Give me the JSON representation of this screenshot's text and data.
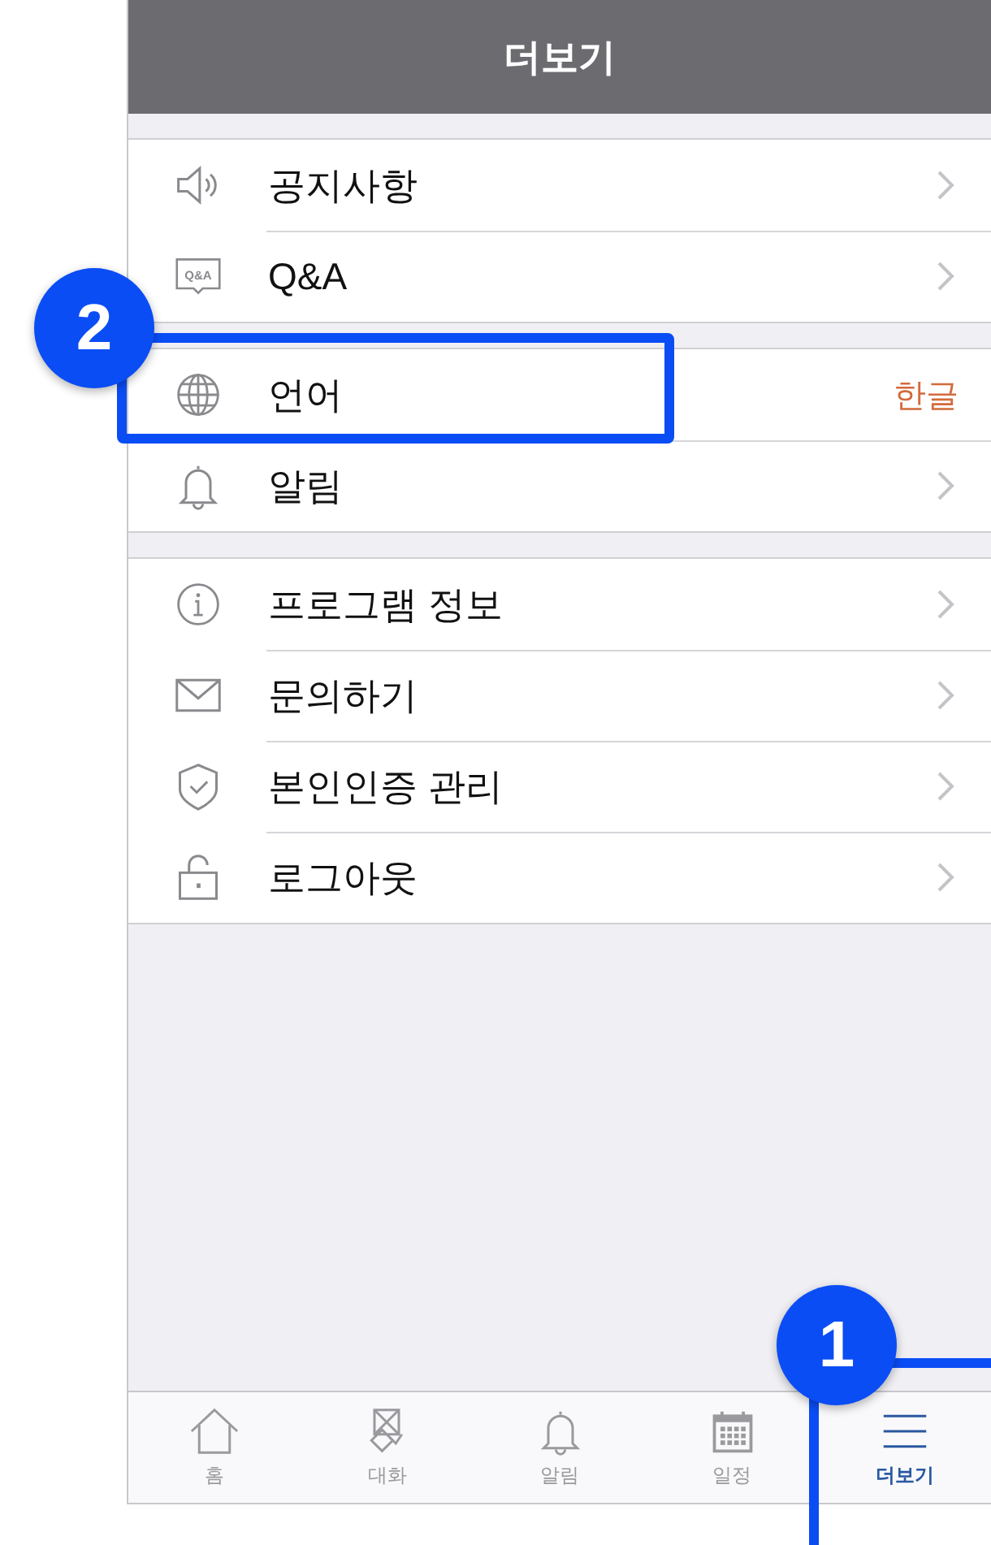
{
  "header": {
    "title": "더보기"
  },
  "groups": [
    {
      "items": [
        {
          "label": "공지사항",
          "kind": "link"
        },
        {
          "icon_text": "Q&A",
          "label": "Q&A",
          "kind": "link"
        }
      ]
    },
    {
      "items": [
        {
          "label": "언어",
          "kind": "value",
          "value": "한글"
        },
        {
          "label": "알림",
          "kind": "link"
        }
      ]
    },
    {
      "items": [
        {
          "label": "프로그램 정보",
          "kind": "link"
        },
        {
          "label": "문의하기",
          "kind": "link"
        },
        {
          "label": "본인인증 관리",
          "kind": "link"
        },
        {
          "label": "로그아웃",
          "kind": "link"
        }
      ]
    }
  ],
  "tab_bar": [
    {
      "label": "홈",
      "selected": false
    },
    {
      "label": "대화",
      "selected": false
    },
    {
      "label": "알림",
      "selected": false
    },
    {
      "label": "일정",
      "selected": false
    },
    {
      "label": "더보기",
      "selected": true
    }
  ],
  "annotations": [
    {
      "number": "2"
    },
    {
      "number": "1"
    }
  ]
}
